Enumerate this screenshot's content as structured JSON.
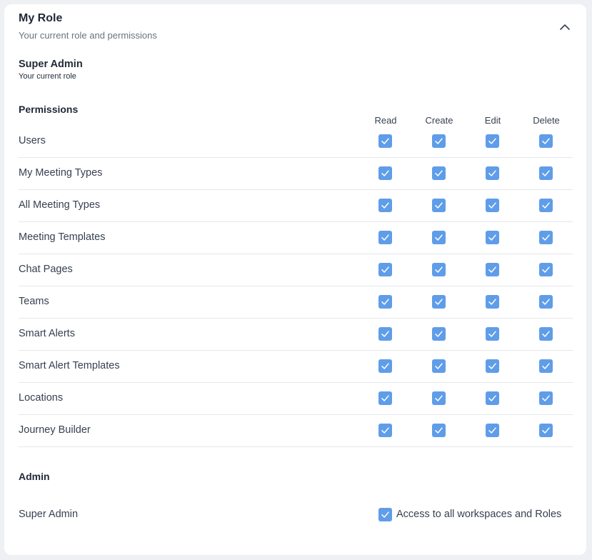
{
  "header": {
    "title": "My Role",
    "subtitle": "Your current role and permissions"
  },
  "role": {
    "name": "Super Admin",
    "subtitle": "Your current role"
  },
  "permissions": {
    "heading": "Permissions",
    "columns": [
      "Read",
      "Create",
      "Edit",
      "Delete"
    ],
    "rows": [
      {
        "label": "Users",
        "read": true,
        "create": true,
        "edit": true,
        "delete": true
      },
      {
        "label": "My Meeting Types",
        "read": true,
        "create": true,
        "edit": true,
        "delete": true
      },
      {
        "label": "All Meeting Types",
        "read": true,
        "create": true,
        "edit": true,
        "delete": true
      },
      {
        "label": "Meeting Templates",
        "read": true,
        "create": true,
        "edit": true,
        "delete": true
      },
      {
        "label": "Chat Pages",
        "read": true,
        "create": true,
        "edit": true,
        "delete": true
      },
      {
        "label": "Teams",
        "read": true,
        "create": true,
        "edit": true,
        "delete": true
      },
      {
        "label": "Smart Alerts",
        "read": true,
        "create": true,
        "edit": true,
        "delete": true
      },
      {
        "label": "Smart Alert Templates",
        "read": true,
        "create": true,
        "edit": true,
        "delete": true
      },
      {
        "label": "Locations",
        "read": true,
        "create": true,
        "edit": true,
        "delete": true
      },
      {
        "label": "Journey Builder",
        "read": true,
        "create": true,
        "edit": true,
        "delete": true
      }
    ]
  },
  "admin": {
    "heading": "Admin",
    "label": "Super Admin",
    "access_label": "Access to all workspaces and Roles",
    "access_checked": true
  },
  "colors": {
    "checkbox": "#5f9de9",
    "card_background": "#ffffff",
    "page_background": "#eef0f3"
  },
  "icons": {
    "collapse": "chevron-up-icon",
    "checkbox": "check-icon"
  }
}
